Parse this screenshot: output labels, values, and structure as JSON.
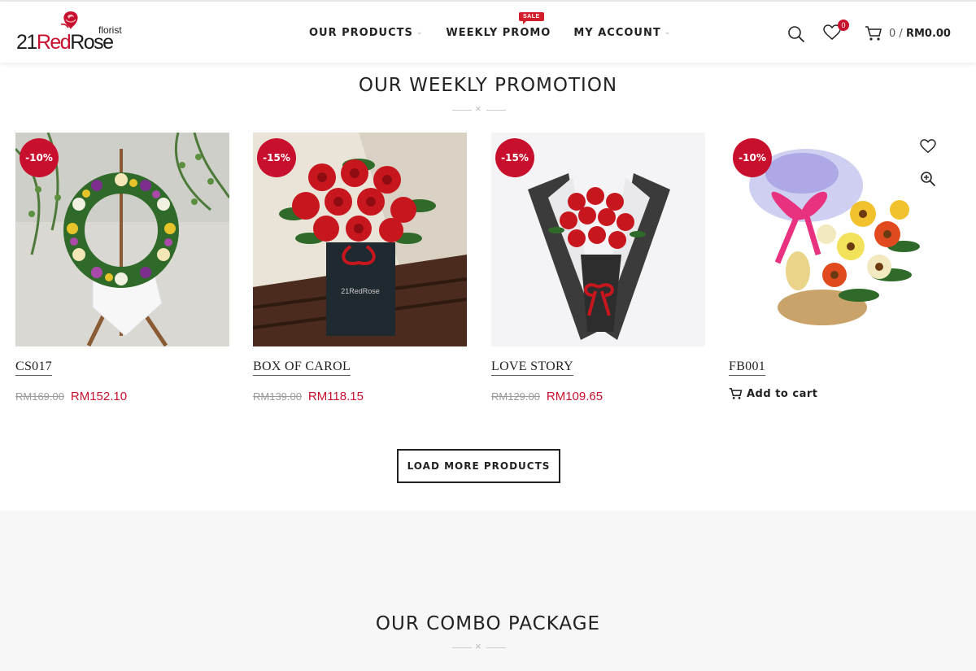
{
  "brand": {
    "logo_prefix": "21",
    "logo_red": "Red",
    "logo_suffix": "Rose",
    "logo_tag": "florist",
    "accent_color": "#c8102e"
  },
  "nav": {
    "items": [
      {
        "label": "OUR PRODUCTS",
        "has_dropdown": true
      },
      {
        "label": "WEEKLY PROMO",
        "has_dropdown": false
      },
      {
        "label": "MY ACCOUNT",
        "has_dropdown": true
      }
    ],
    "sale_badge": "SALE"
  },
  "header_actions": {
    "search_icon": "search-icon",
    "wishlist_count": "0",
    "cart_count": "0",
    "cart_separator": "/",
    "cart_total": "RM0.00"
  },
  "weekly": {
    "title": "OUR WEEKLY PROMOTION",
    "products": [
      {
        "badge": "-10%",
        "name": "CS017",
        "old_price": "RM169.00",
        "new_price": "RM152.10"
      },
      {
        "badge": "-15%",
        "name": "BOX OF CAROL",
        "old_price": "RM139.00",
        "new_price": "RM118.15"
      },
      {
        "badge": "-15%",
        "name": "LOVE STORY",
        "old_price": "RM129.00",
        "new_price": "RM109.65"
      },
      {
        "badge": "-10%",
        "name": "FB001",
        "add_to_cart": "Add to cart"
      }
    ],
    "load_more": "LOAD MORE PRODUCTS"
  },
  "combo": {
    "title": "OUR COMBO PACKAGE"
  }
}
